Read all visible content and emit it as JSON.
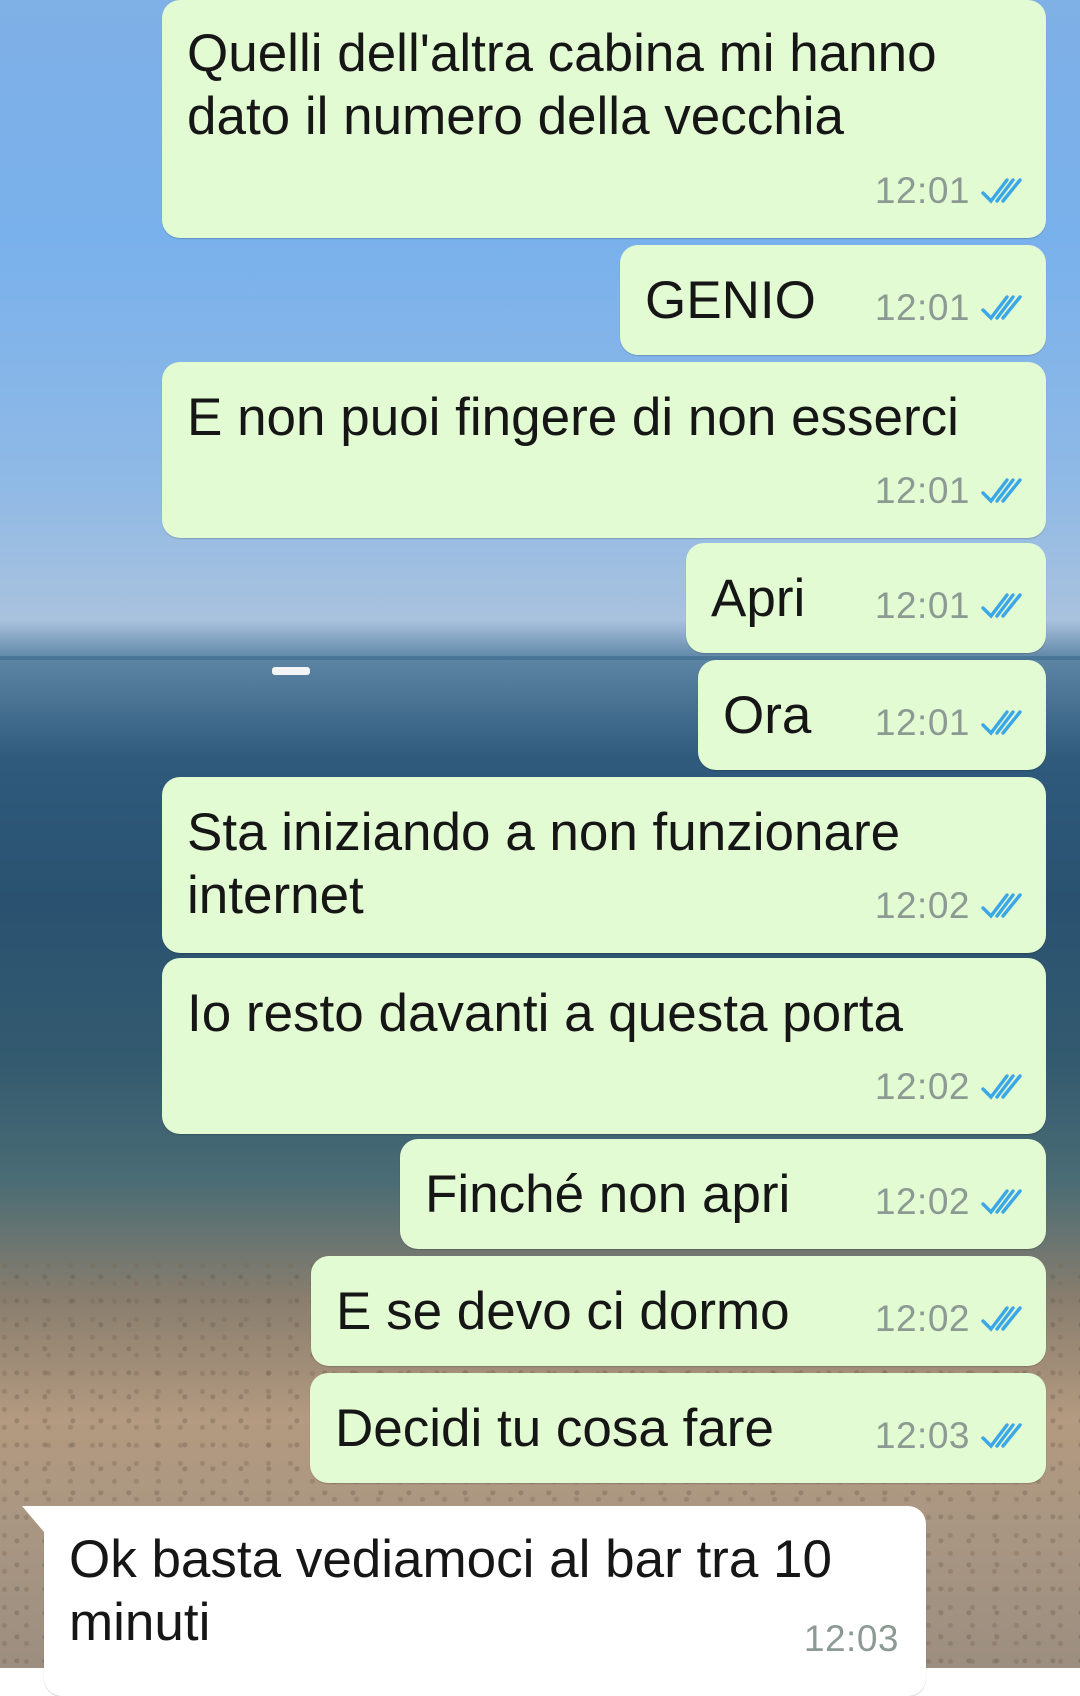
{
  "colors": {
    "outgoing_bubble": "#e2fbd3",
    "incoming_bubble": "#ffffff",
    "read_ticks": "#3ba7e6",
    "timestamp": "#8c9a93"
  },
  "messages": [
    {
      "direction": "outgoing",
      "text": "Quelli dell'altra cabina mi hanno dato il numero della vecchia",
      "time": "12:01",
      "status": "read-double-tick-icon"
    },
    {
      "direction": "outgoing",
      "text": "GENIO",
      "time": "12:01",
      "status": "read-double-tick-icon"
    },
    {
      "direction": "outgoing",
      "text": "E non puoi fingere di non esserci",
      "time": "12:01",
      "status": "read-double-tick-icon"
    },
    {
      "direction": "outgoing",
      "text": "Apri",
      "time": "12:01",
      "status": "read-double-tick-icon"
    },
    {
      "direction": "outgoing",
      "text": "Ora",
      "time": "12:01",
      "status": "read-double-tick-icon"
    },
    {
      "direction": "outgoing",
      "text": "Sta iniziando a non funzionare internet",
      "time": "12:02",
      "status": "read-double-tick-icon"
    },
    {
      "direction": "outgoing",
      "text": "Io resto davanti a questa porta",
      "time": "12:02",
      "status": "read-double-tick-icon"
    },
    {
      "direction": "outgoing",
      "text": "Finché non apri",
      "time": "12:02",
      "status": "read-double-tick-icon"
    },
    {
      "direction": "outgoing",
      "text": "E se devo ci dormo",
      "time": "12:02",
      "status": "read-double-tick-icon"
    },
    {
      "direction": "outgoing",
      "text": "Decidi tu cosa fare",
      "time": "12:03",
      "status": "read-double-tick-icon"
    },
    {
      "direction": "incoming",
      "text": "Ok basta vediamoci al bar tra 10 minuti",
      "time": "12:03"
    }
  ]
}
